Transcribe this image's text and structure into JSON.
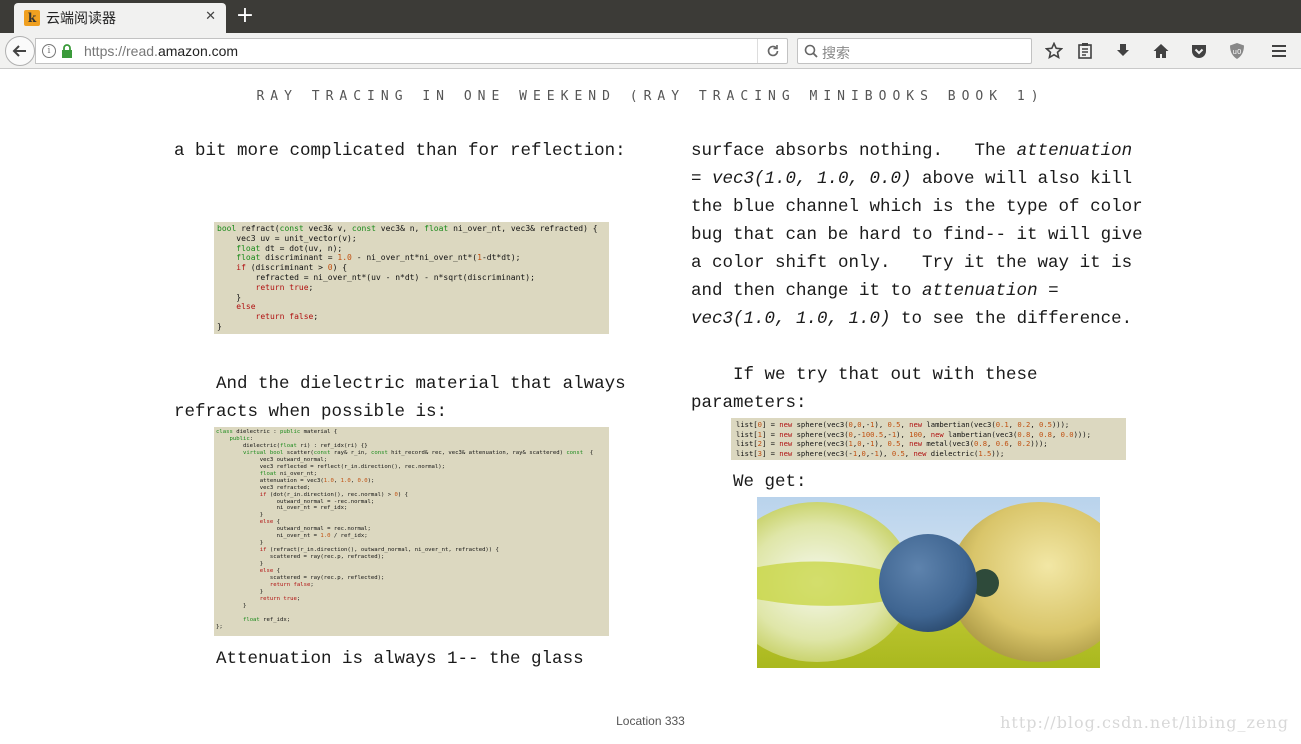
{
  "browser": {
    "tab_title": "云端阅读器",
    "tab_favicon_letter": "k",
    "url_prefix": "https://read.",
    "url_domain": "amazon.com",
    "search_placeholder": "搜索"
  },
  "reader": {
    "running_head": "RAY TRACING IN ONE WEEKEND (RAY TRACING MINIBOOKS BOOK 1)",
    "left_col": {
      "line1": "a bit more complicated than for reflection:",
      "para2_line1": "    And the dielectric material that always",
      "para2_line2": "refracts when possible is:",
      "para3_line1": "    Attenuation is always 1-- the glass"
    },
    "right_col": {
      "l1a": "surface absorbs nothing.   The ",
      "l1b": "attenuation",
      "l2a": "= vec3(1.0, 1.0, 0.0)",
      "l2b": " above will also kill",
      "l3": "the blue channel which is the type of color",
      "l4": "bug that can be hard to find-- it will give",
      "l5": "a color shift only.   Try it the way it is",
      "l6a": "and then change it to ",
      "l6b": "attenuation =",
      "l7a": "vec3(1.0, 1.0, 1.0)",
      "l7b": " to see the difference.",
      "p2_l1": "    If we try that out with these",
      "p2_l2": "parameters:",
      "p3_l1": "    We get:"
    },
    "code_refract": [
      "bool refract(const vec3& v, const vec3& n, float ni_over_nt, vec3& refracted) {",
      "    vec3 uv = unit_vector(v);",
      "    float dt = dot(uv, n);",
      "    float discriminant = 1.0 - ni_over_nt*ni_over_nt*(1-dt*dt);",
      "    if (discriminant > 0) {",
      "        refracted = ni_over_nt*(uv - n*dt) - n*sqrt(discriminant);",
      "        return true;",
      "    }",
      "    else",
      "        return false;",
      "}"
    ],
    "code_dielectric": [
      "class dielectric : public material {",
      "    public:",
      "        dielectric(float ri) : ref_idx(ri) {}",
      "        virtual bool scatter(const ray& r_in, const hit_record& rec, vec3& attenuation, ray& scattered) const  {",
      "             vec3 outward_normal;",
      "             vec3 reflected = reflect(r_in.direction(), rec.normal);",
      "             float ni_over_nt;",
      "             attenuation = vec3(1.0, 1.0, 0.0);",
      "             vec3 refracted;",
      "             if (dot(r_in.direction(), rec.normal) > 0) {",
      "                  outward_normal = -rec.normal;",
      "                  ni_over_nt = ref_idx;",
      "             }",
      "             else {",
      "                  outward_normal = rec.normal;",
      "                  ni_over_nt = 1.0 / ref_idx;",
      "             }",
      "             if (refract(r_in.direction(), outward_normal, ni_over_nt, refracted)) {",
      "                scattered = ray(rec.p, refracted);",
      "             }",
      "             else {",
      "                scattered = ray(rec.p, reflected);",
      "                return false;",
      "             }",
      "             return true;",
      "        }",
      "",
      "        float ref_idx;",
      "};"
    ],
    "code_list": [
      "list[0] = new sphere(vec3(0,0,-1), 0.5, new lambertian(vec3(0.1, 0.2, 0.5)));",
      "list[1] = new sphere(vec3(0,-100.5,-1), 100, new lambertian(vec3(0.8, 0.8, 0.0)));",
      "list[2] = new sphere(vec3(1,0,-1), 0.5, new metal(vec3(0.8, 0.6, 0.2)));",
      "list[3] = new sphere(vec3(-1,0,-1), 0.5, new dielectric(1.5));"
    ],
    "location": "Location 333",
    "watermark": "http://blog.csdn.net/libing_zeng"
  },
  "colors": {
    "code_bg": "#dcd8c0",
    "keyword": "#1a8a1a",
    "literal": "#b01010",
    "tabbar": "#3c3b37"
  }
}
